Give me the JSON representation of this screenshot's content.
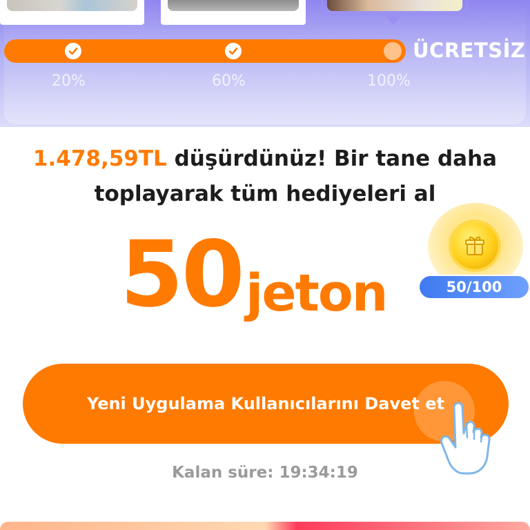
{
  "progress": {
    "free_label": "ÜCRETSİZ",
    "milestones": [
      {
        "label": "20%",
        "done": true
      },
      {
        "label": "60%",
        "done": true
      },
      {
        "label": "100%",
        "done": false
      }
    ],
    "accent": "#ff7a00"
  },
  "message": {
    "amount": "1.478,59TL",
    "line1_rest": " düşürdünüz! Bir tane daha",
    "line2": "toplayarak tüm hediyeleri al"
  },
  "reward": {
    "amount": "50",
    "unit": "jeton"
  },
  "coin": {
    "counter": "50/100",
    "icon": "gift-coin-icon"
  },
  "cta": {
    "label": "Yeni Uygulama Kullanıcılarını Davet et"
  },
  "timer": {
    "label": "Kalan süre: 19:34:19"
  },
  "colors": {
    "orange": "#ff7a00",
    "purple": "#9a8ff0",
    "blue_pill": "#4f86f5",
    "gray_text": "#9a9a9a"
  }
}
